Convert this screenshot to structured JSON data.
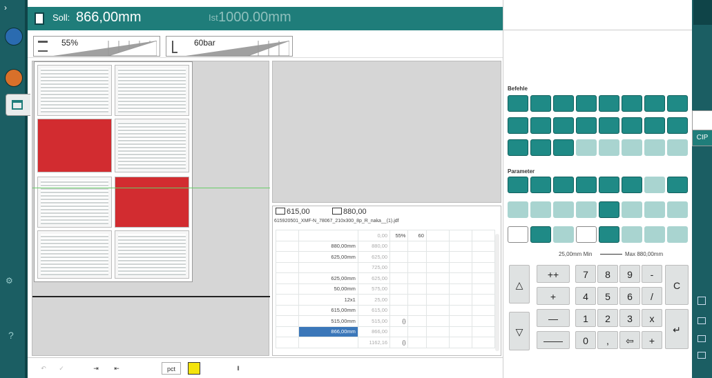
{
  "header": {
    "soll_label": "Soll:",
    "soll_value": "866,00mm",
    "ist_label": "Ist",
    "ist_value": "1000.00mm"
  },
  "sliders": {
    "percent": "55%",
    "pressure": "60bar"
  },
  "table_panel": {
    "width_a": "615,00",
    "width_b": "880,00",
    "filename": "615920501_XMF-N_78067_210x300_8p_R_naka__(1).jdf",
    "rows": [
      {
        "value": "",
        "actual": "0,00",
        "extra": "55%",
        "extra2": "60",
        "selected": false
      },
      {
        "value": "880,00mm",
        "actual": "880,00",
        "extra": "",
        "extra2": "",
        "selected": false
      },
      {
        "value": "625,00mm",
        "actual": "625,00",
        "extra": "",
        "extra2": "",
        "selected": false
      },
      {
        "value": "",
        "actual": "725,00",
        "extra": "",
        "extra2": "",
        "selected": false
      },
      {
        "value": "625,00mm",
        "actual": "625,00",
        "extra": "",
        "extra2": "",
        "selected": false
      },
      {
        "value": "50,00mm",
        "actual": "575,00",
        "extra": "",
        "extra2": "",
        "selected": false
      },
      {
        "value": "12x1",
        "actual": "25,00",
        "extra": "",
        "extra2": "",
        "selected": false
      },
      {
        "value": "615,00mm",
        "actual": "615,00",
        "extra": "",
        "extra2": "",
        "selected": false
      },
      {
        "value": "515,00mm",
        "actual": "515,00",
        "extra": "{}",
        "extra2": "",
        "selected": false
      },
      {
        "value": "866,00mm",
        "actual": "866,00",
        "extra": "",
        "extra2": "",
        "selected": true
      },
      {
        "value": "",
        "actual": "1162,16",
        "extra": "{}",
        "extra2": "",
        "selected": false
      }
    ]
  },
  "right_panel": {
    "befehle_label": "Befehle",
    "parameter_label": "Parameter",
    "range_min": "25,00mm Min",
    "range_max": "Max 880,00mm",
    "cip_label": "CIP"
  },
  "keypad": {
    "up": "△",
    "down": "▽",
    "plusplus": "++",
    "plus": "+",
    "minus": "—",
    "minusminus": "——",
    "digits": [
      "7",
      "8",
      "9",
      "4",
      "5",
      "6",
      "1",
      "2",
      "3",
      "0"
    ],
    "dash": "-",
    "slash": "/",
    "x": "x",
    "comma": ",",
    "back": "⇦",
    "plus2": "+",
    "clear": "C",
    "enter": "↵"
  },
  "bottom": {
    "pct_label": "pct"
  },
  "colors": {
    "teal_dark": "#1b5e63",
    "teal": "#1f7d7a",
    "button": "#1f8a86",
    "selected_row": "#3b77b9",
    "accent_yellow": "#f4e40c"
  }
}
